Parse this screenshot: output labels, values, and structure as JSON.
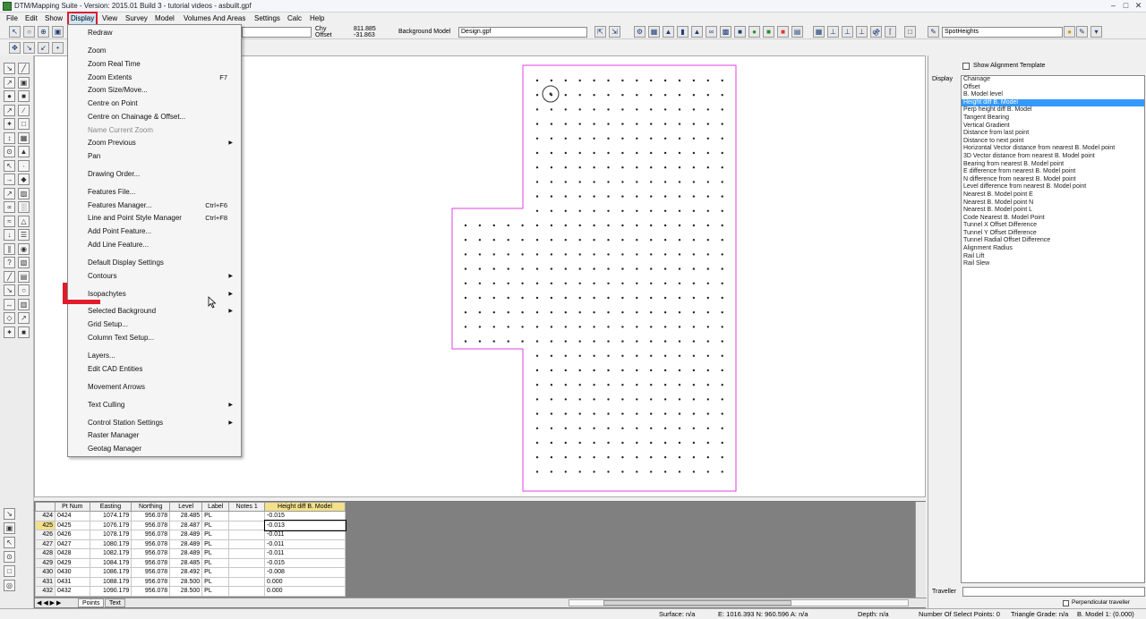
{
  "window": {
    "title": "DTM/Mapping Suite - Version: 2015.01 Build 3 - tutorial videos - asbuilt.gpf",
    "controls": [
      "minimize",
      "maximize",
      "close"
    ]
  },
  "menubar": {
    "items": [
      "File",
      "Edit",
      "Show",
      "Display",
      "View",
      "Survey",
      "Model",
      "Volumes And Areas",
      "Settings",
      "Calc",
      "Help"
    ],
    "active": "Display"
  },
  "toolbar": {
    "chy_label": "Chy",
    "offset_label": "Offset",
    "chy_value": "811.885",
    "offset_value": "-31.863",
    "background_model_label": "Background Model",
    "background_model_value": "Design.gpf",
    "style_value": "SpotHeights"
  },
  "display_menu": {
    "items": [
      {
        "label": "Redraw",
        "shortcut": "",
        "submenu": false,
        "disabled": false
      },
      {
        "label": "Zoom",
        "shortcut": "",
        "submenu": false,
        "disabled": false
      },
      {
        "label": "Zoom Real Time",
        "shortcut": "",
        "submenu": false,
        "disabled": false
      },
      {
        "label": "Zoom Extents",
        "shortcut": "F7",
        "submenu": false,
        "disabled": false
      },
      {
        "label": "Zoom Size/Move...",
        "shortcut": "",
        "submenu": false,
        "disabled": false
      },
      {
        "label": "Centre on Point",
        "shortcut": "",
        "submenu": false,
        "disabled": false
      },
      {
        "label": "Centre on Chainage & Offset...",
        "shortcut": "",
        "submenu": false,
        "disabled": false
      },
      {
        "label": "Name Current Zoom",
        "shortcut": "",
        "submenu": false,
        "disabled": true
      },
      {
        "label": "Zoom Previous",
        "shortcut": "",
        "submenu": true,
        "disabled": false
      },
      {
        "label": "Pan",
        "shortcut": "",
        "submenu": false,
        "disabled": false
      },
      {
        "label": "Drawing Order...",
        "shortcut": "",
        "submenu": false,
        "disabled": false
      },
      {
        "label": "Features File...",
        "shortcut": "",
        "submenu": false,
        "disabled": false
      },
      {
        "label": "Features Manager...",
        "shortcut": "Ctrl+F6",
        "submenu": false,
        "disabled": false
      },
      {
        "label": "Line and Point Style Manager",
        "shortcut": "Ctrl+F8",
        "submenu": false,
        "disabled": false
      },
      {
        "label": "Add Point Feature...",
        "shortcut": "",
        "submenu": false,
        "disabled": false
      },
      {
        "label": "Add Line Feature...",
        "shortcut": "",
        "submenu": false,
        "disabled": false
      },
      {
        "label": "Default Display Settings",
        "shortcut": "",
        "submenu": false,
        "disabled": false
      },
      {
        "label": "Contours",
        "shortcut": "",
        "submenu": true,
        "disabled": false
      },
      {
        "label": "Isopachytes",
        "shortcut": "",
        "submenu": true,
        "disabled": false
      },
      {
        "label": "Selected Background",
        "shortcut": "",
        "submenu": true,
        "disabled": false
      },
      {
        "label": "Grid Setup...",
        "shortcut": "",
        "submenu": false,
        "disabled": false
      },
      {
        "label": "Column Text Setup...",
        "shortcut": "",
        "submenu": false,
        "disabled": false
      },
      {
        "label": "Layers...",
        "shortcut": "",
        "submenu": false,
        "disabled": false
      },
      {
        "label": "Edit CAD Entities",
        "shortcut": "",
        "submenu": false,
        "disabled": false
      },
      {
        "label": "Movement Arrows",
        "shortcut": "",
        "submenu": false,
        "disabled": false
      },
      {
        "label": "Text Culling",
        "shortcut": "",
        "submenu": true,
        "disabled": false
      },
      {
        "label": "Control Station Settings",
        "shortcut": "",
        "submenu": true,
        "disabled": false
      },
      {
        "label": "Raster Manager",
        "shortcut": "",
        "submenu": false,
        "disabled": false
      },
      {
        "label": "Geotag Manager",
        "shortcut": "",
        "submenu": false,
        "disabled": false
      }
    ]
  },
  "right_panel": {
    "show_alignment_label": "Show Alignment Template",
    "display_label": "Display",
    "traveller_label": "Traveller",
    "perpendicular_label": "Perpendicular traveller",
    "items": [
      "Chainage",
      "Offset",
      "B. Model level",
      "Height diff B. Model",
      "Perp height diff B. Model",
      "Tangent Bearing",
      "Vertical Gradient",
      "Distance from last point",
      "Distance to next point",
      "Horizontal Vector distance from nearest B. Model point",
      "3D Vector distance from nearest B. Model point",
      "Bearing from nearest B. Model point",
      "E difference from nearest B. Model point",
      "N difference from nearest B. Model point",
      "Level difference from nearest B. Model point",
      "Nearest B. Model point E",
      "Nearest B. Model point N",
      "Nearest B. Model point L",
      "Code Nearest B. Model Point",
      "Tunnel X Offset Difference",
      "Tunnel Y Offset Difference",
      "Tunnel Radial Offset Difference",
      "Alignment Radius",
      "Rail Lift",
      "Rail Slew"
    ],
    "selected": "Height diff B. Model"
  },
  "grid": {
    "columns": [
      "Pt Num",
      "Easting",
      "Northing",
      "Level",
      "Label",
      "Notes 1",
      "Height diff B. Model"
    ],
    "rows": [
      {
        "rn": "424",
        "cells": [
          "0424",
          "1074.179",
          "956.078",
          "28.485",
          "PL",
          "",
          "-0.015"
        ]
      },
      {
        "rn": "425",
        "cells": [
          "0425",
          "1076.179",
          "956.078",
          "28.487",
          "PL",
          "",
          "-0.013"
        ]
      },
      {
        "rn": "426",
        "cells": [
          "0426",
          "1078.179",
          "956.078",
          "28.489",
          "PL",
          "",
          "-0.011"
        ]
      },
      {
        "rn": "427",
        "cells": [
          "0427",
          "1080.179",
          "956.078",
          "28.489",
          "PL",
          "",
          "-0.011"
        ]
      },
      {
        "rn": "428",
        "cells": [
          "0428",
          "1082.179",
          "956.078",
          "28.489",
          "PL",
          "",
          "-0.011"
        ]
      },
      {
        "rn": "429",
        "cells": [
          "0429",
          "1084.179",
          "956.078",
          "28.485",
          "PL",
          "",
          "-0.015"
        ]
      },
      {
        "rn": "430",
        "cells": [
          "0430",
          "1086.179",
          "956.078",
          "28.492",
          "PL",
          "",
          "-0.008"
        ]
      },
      {
        "rn": "431",
        "cells": [
          "0431",
          "1088.179",
          "956.078",
          "28.500",
          "PL",
          "",
          "0.000"
        ]
      },
      {
        "rn": "432",
        "cells": [
          "0432",
          "1090.179",
          "956.078",
          "28.500",
          "PL",
          "",
          "0.000"
        ]
      }
    ],
    "selected_row": "425",
    "tabs": [
      "Points",
      "Text"
    ]
  },
  "statusbar": {
    "surface": "Surface: n/a",
    "coords": "E: 1016.393  N: 960.596  A: n/a",
    "depth": "Depth: n/a",
    "select_points": "Number Of Select Points: 0",
    "triangle_grade": "Triangle Grade: n/a",
    "bmodel": "B. Model 1: (0.000)"
  }
}
